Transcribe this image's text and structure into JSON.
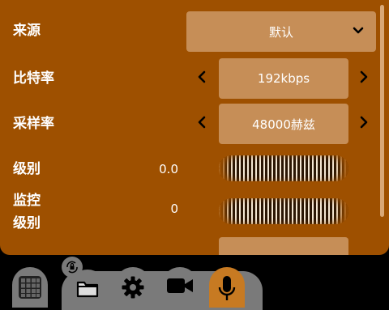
{
  "settings": {
    "source": {
      "label": "来源",
      "selected": "默认"
    },
    "bitrate": {
      "label": "比特率",
      "value": "192kbps"
    },
    "samplerate": {
      "label": "采样率",
      "value": "48000赫兹"
    },
    "level": {
      "label": "级别",
      "value": "0.0"
    },
    "monitor_level": {
      "label_line1": "监控",
      "label_line2": "级别",
      "value": "0"
    }
  },
  "colors": {
    "panel": "#9e5000",
    "control": "#c68e57",
    "active_tab": "#c77a22",
    "inactive_tab": "#7a7a7a"
  },
  "tabs": [
    {
      "icon": "grid-icon",
      "active": false
    },
    {
      "icon": "folder-icon",
      "active": false
    },
    {
      "icon": "gear-icon",
      "active": false
    },
    {
      "icon": "video-camera-icon",
      "active": false
    },
    {
      "icon": "microphone-icon",
      "active": true
    }
  ]
}
